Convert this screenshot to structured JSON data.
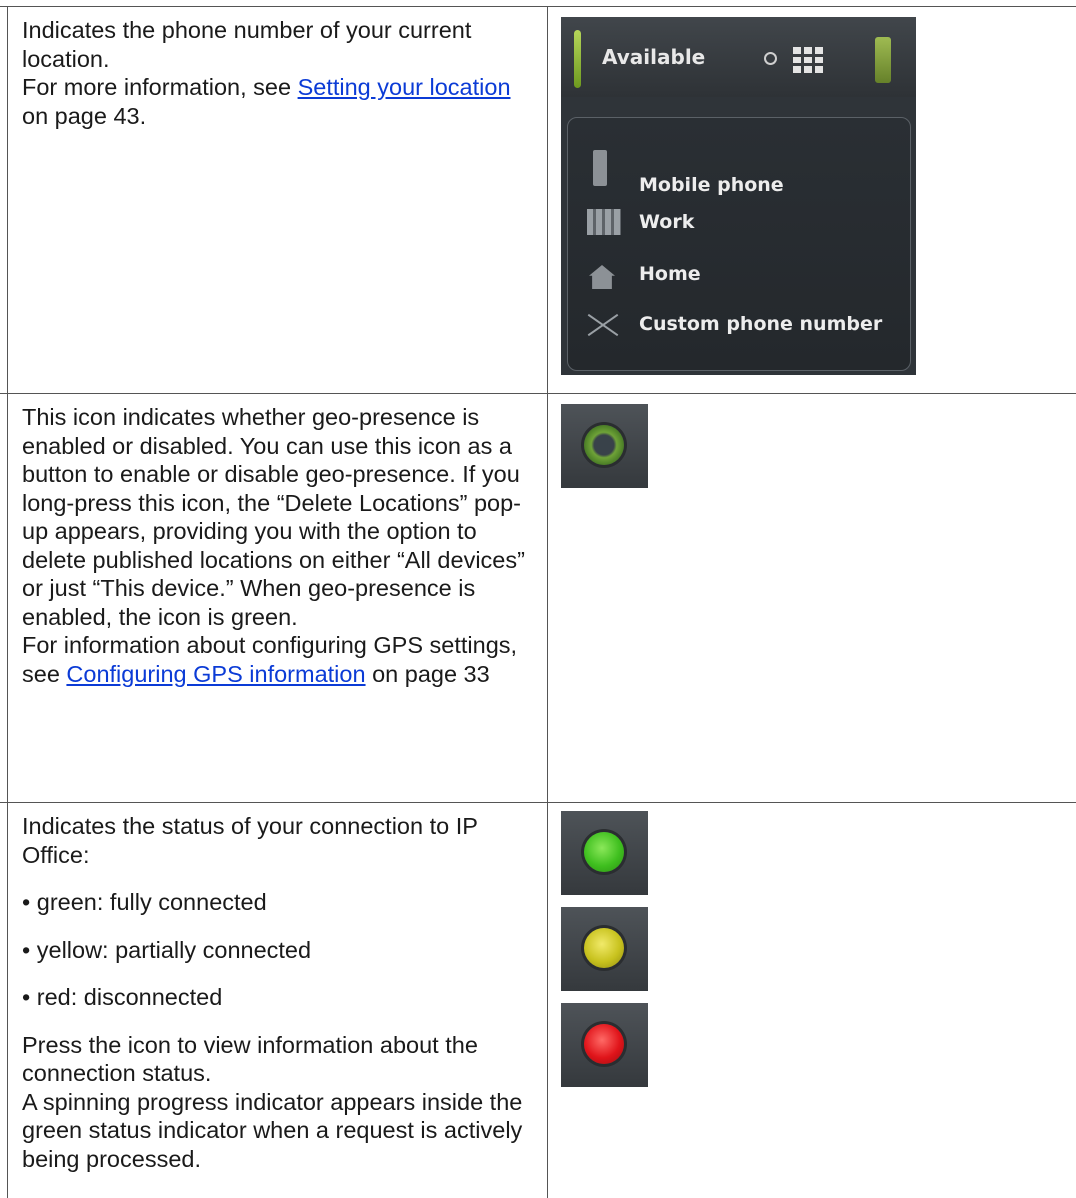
{
  "row1": {
    "text1": "Indicates the phone number of your current location.",
    "text2_prefix": "For more information, see ",
    "link": "Setting your location",
    "text2_suffix": " on page 43.",
    "screenshot": {
      "status": "Available",
      "menu_items": [
        "Mobile phone",
        "Work",
        "Home",
        "Custom phone number"
      ]
    }
  },
  "row2": {
    "text1": "This icon indicates whether geo-presence is enabled or disabled. You can use this icon as a button to enable or disable geo-presence. If you long-press this icon, the “Delete Locations” pop-up appears, providing you with the option to delete published locations on either “All devices” or just “This device.” When geo-presence is enabled, the icon is green.",
    "text2_prefix": "For information about configuring GPS settings, see ",
    "link": "Configuring GPS information",
    "text2_suffix": " on page 33"
  },
  "row3": {
    "text1": "Indicates the status of your connection to IP Office:",
    "bullets": [
      "• green: fully connected",
      "• yellow: partially connected",
      "• red: disconnected"
    ],
    "text2": "Press the icon to view information about the connection status.",
    "text3": "A spinning progress indicator appears inside the green status indicator when a request is actively being processed."
  },
  "colors": {
    "green": "#3fbf1f",
    "yellow": "#c8c21e",
    "red": "#e0141a",
    "link": "#0b3bd6"
  }
}
